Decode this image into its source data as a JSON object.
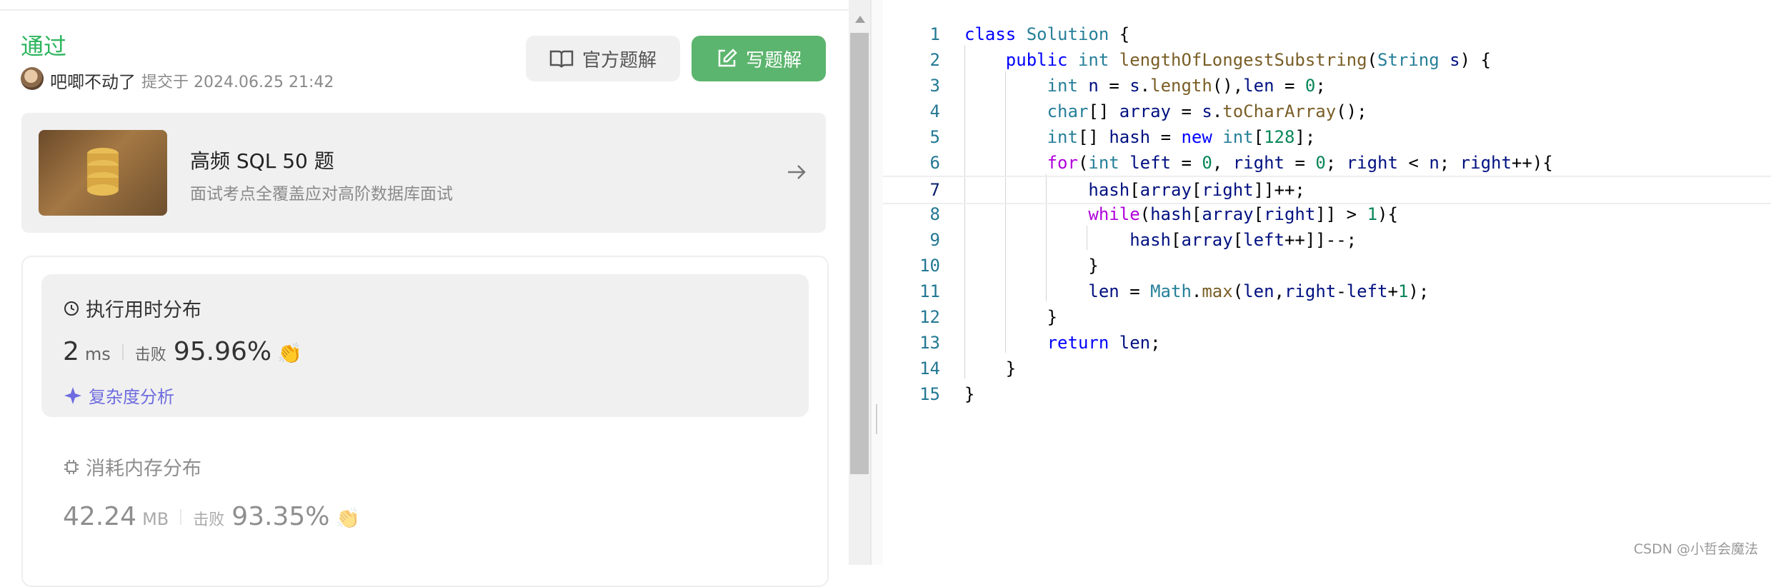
{
  "result": {
    "status": "通过",
    "user": "吧唧不动了",
    "submitted": "提交于 2024.06.25 21:42"
  },
  "buttons": {
    "official": "官方题解",
    "write": "写题解"
  },
  "promo": {
    "title": "高频 SQL 50 题",
    "subtitle": "面试考点全覆盖应对高阶数据库面试"
  },
  "runtime": {
    "title": "执行用时分布",
    "value": "2",
    "unit": "ms",
    "beat_label": "击败",
    "beat": "95.96%",
    "complexity": "复杂度分析"
  },
  "memory": {
    "title": "消耗内存分布",
    "value": "42.24",
    "unit": "MB",
    "beat_label": "击败",
    "beat": "93.35%"
  },
  "editor": {
    "lines": [
      {
        "n": "1",
        "code": "class Solution {"
      },
      {
        "n": "2",
        "code": "    public int lengthOfLongestSubstring(String s) {"
      },
      {
        "n": "3",
        "code": "        int n = s.length(),len = 0;"
      },
      {
        "n": "4",
        "code": "        char[] array = s.toCharArray();"
      },
      {
        "n": "5",
        "code": "        int[] hash = new int[128];"
      },
      {
        "n": "6",
        "code": "        for(int left = 0, right = 0; right < n; right++){"
      },
      {
        "n": "7",
        "code": "            hash[array[right]]++;"
      },
      {
        "n": "8",
        "code": "            while(hash[array[right]] > 1){"
      },
      {
        "n": "9",
        "code": "                hash[array[left++]]--;"
      },
      {
        "n": "10",
        "code": "            }"
      },
      {
        "n": "11",
        "code": "            len = Math.max(len,right-left+1);"
      },
      {
        "n": "12",
        "code": "        }"
      },
      {
        "n": "13",
        "code": "        return len;"
      },
      {
        "n": "14",
        "code": "    }"
      },
      {
        "n": "15",
        "code": "}"
      }
    ]
  },
  "watermark": "CSDN @小哲会魔法",
  "colors": {
    "success": "#2db55d",
    "primary_button": "#5cb56e",
    "accent": "#6e6cdf"
  },
  "icons": [
    "book-icon",
    "edit-icon",
    "database-icon",
    "arrow-right-icon",
    "clock-icon",
    "clap-icon",
    "sparkle-icon",
    "chip-icon"
  ]
}
